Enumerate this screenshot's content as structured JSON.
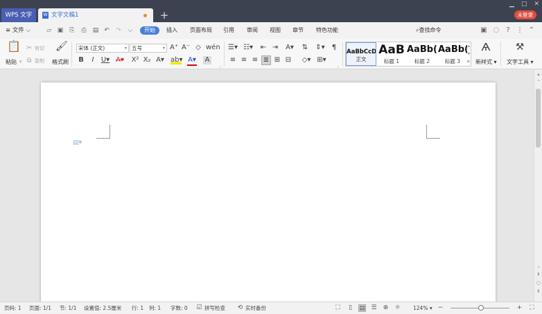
{
  "titlebar": {
    "app_tab": "WPS 文字",
    "doc_tab": "文字文稿1",
    "new_tab_symbol": "+",
    "login": "未登录",
    "controls": [
      "▁",
      "□",
      "✕"
    ]
  },
  "menubar": {
    "file": "≡ 文件 ⌵",
    "tabs": [
      "开始",
      "插入",
      "页面布局",
      "引用",
      "审阅",
      "视图",
      "章节",
      "特色功能"
    ],
    "search": "⌕查找命令"
  },
  "ribbon": {
    "paste": "粘贴",
    "cut": "剪切",
    "copy": "复制",
    "format_painter": "格式刷",
    "font_name": "宋体 (正文)",
    "font_size": "五号",
    "styles": [
      {
        "sample": "AaBbCcD",
        "name": "正文"
      },
      {
        "sample": "AaB",
        "name": "标题 1"
      },
      {
        "sample": "AaBb(",
        "name": "标题 2"
      },
      {
        "sample": "AaBb(",
        "name": "标题 3"
      }
    ],
    "new_style": "新样式",
    "text_tools": "文字工具"
  },
  "statusbar": {
    "page_no": "页码: 1",
    "pages": "页面: 1/1",
    "section": "节: 1/1",
    "setting": "设置值: 2.5厘米",
    "row": "行: 1",
    "col": "列: 1",
    "words": "字数: 0",
    "spell": "拼写检查",
    "backup": "实时备份",
    "zoom": "124%",
    "zoom_level_percent": 124
  }
}
